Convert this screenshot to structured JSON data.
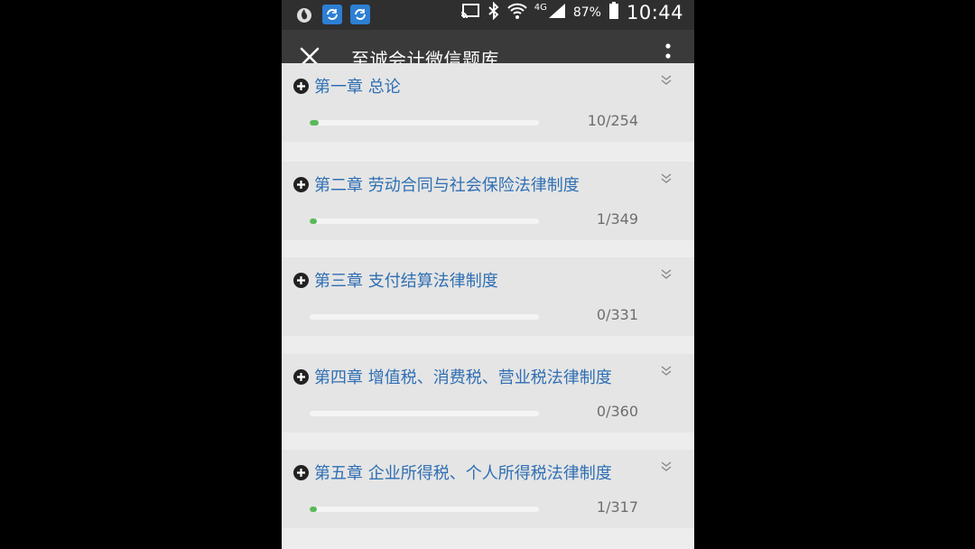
{
  "status_bar": {
    "network": "4G",
    "battery": "87%",
    "time": "10:44",
    "icons": [
      "flame-app-icon",
      "sync-app-icon",
      "sync-app-icon",
      "cast-icon",
      "bluetooth-icon",
      "wifi-icon",
      "signal-icon",
      "battery-icon"
    ]
  },
  "titlebar": {
    "title": "至诚会计微信题库",
    "close_icon": "close-icon",
    "more_icon": "more-vertical-icon",
    "accent": "#4caf50"
  },
  "chapters": [
    {
      "title": "第一章 总论",
      "count": "10/254",
      "progress": 0.039
    },
    {
      "title": "第二章 劳动合同与社会保险法律制度",
      "count": "1/349",
      "progress": 0.003
    },
    {
      "title": "第三章 支付结算法律制度",
      "count": "0/331",
      "progress": 0
    },
    {
      "title": "第四章 增值税、消费税、营业税法律制度",
      "count": "0/360",
      "progress": 0
    },
    {
      "title": "第五章 企业所得税、个人所得税法律制度",
      "count": "1/317",
      "progress": 0.003
    }
  ],
  "colors": {
    "title_text": "#2f6fb3",
    "progress": "#5cb85c",
    "count_text": "#6e6e6e"
  }
}
